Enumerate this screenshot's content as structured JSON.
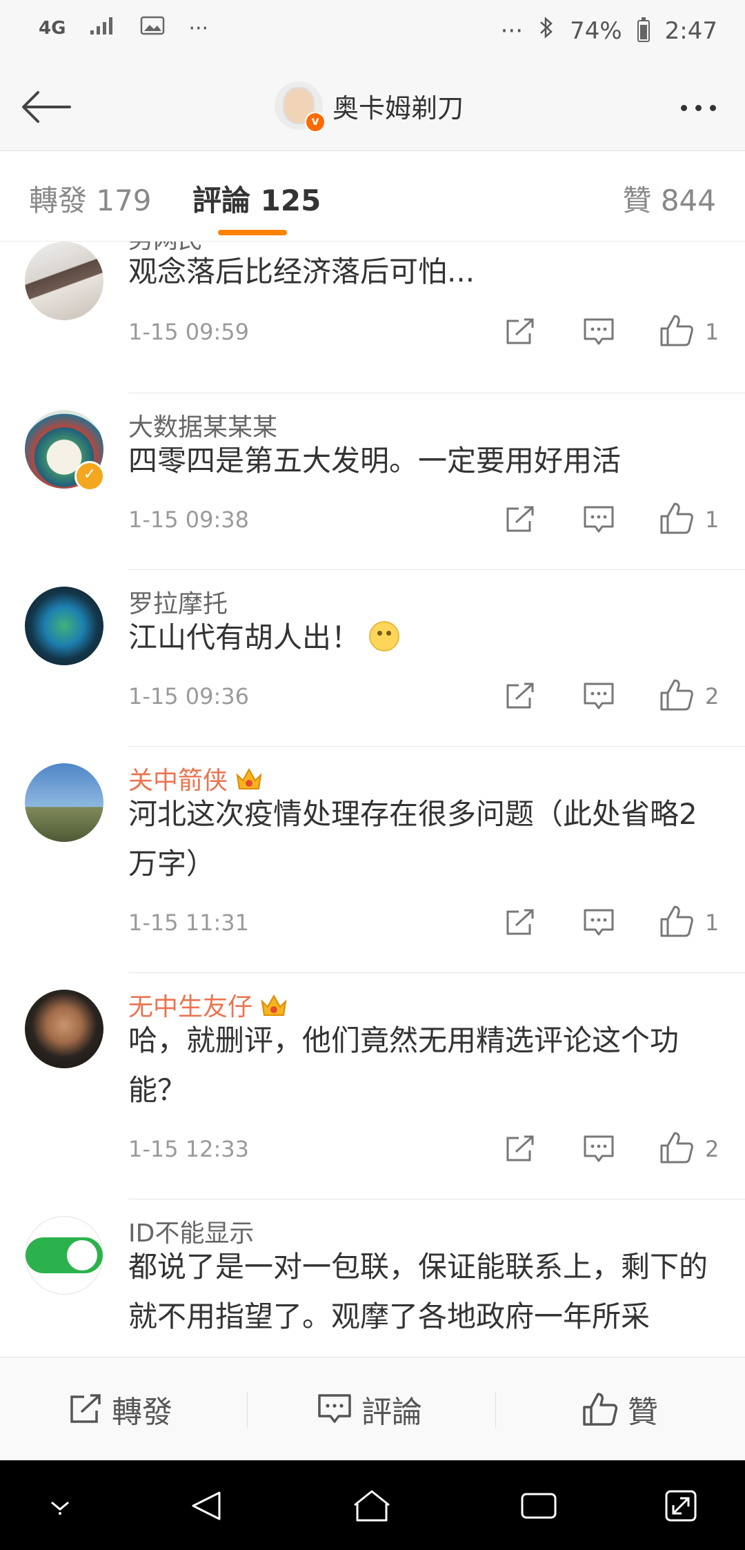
{
  "status_bar": {
    "network": "4G",
    "more_dots": "···",
    "right_dots": "···",
    "battery_percent": "74%",
    "battery_level": 0.74,
    "time": "2:47"
  },
  "header": {
    "title": "奥卡姆剃刀",
    "verified_badge": "v"
  },
  "tabs": {
    "repost": "轉發 179",
    "comments": "評論 125",
    "likes": "贊 844"
  },
  "comments": [
    {
      "user": "男网民",
      "text": "观念落后比经济落后可怕...",
      "time": "1-15 09:59",
      "like_count": "1",
      "badge": "",
      "vip": false
    },
    {
      "user": "大数据某某某",
      "text": "四零四是第五大发明。一定要用好用活",
      "time": "1-15 09:38",
      "like_count": "1",
      "badge": "✓",
      "vip": false
    },
    {
      "user": "罗拉摩托",
      "text": "江山代有胡人出！",
      "time": "1-15 09:36",
      "like_count": "2",
      "badge": "",
      "vip": false
    },
    {
      "user": "关中箭侠",
      "text": "河北这次疫情处理存在很多问题（此处省略2万字）",
      "time": "1-15 11:31",
      "like_count": "1",
      "badge": "",
      "vip": true
    },
    {
      "user": "无中生友仔",
      "text": "哈，就删评，他们竟然无用精选评论这个功能？",
      "time": "1-15 12:33",
      "like_count": "2",
      "badge": "",
      "vip": true
    },
    {
      "user": "ID不能显示",
      "text": "都说了是一对一包联，保证能联系上，剩下的就不用指望了。观摩了各地政府一年所采",
      "time": "",
      "like_count": "",
      "badge": "",
      "vip": false
    }
  ],
  "bottom_bar": {
    "repost": "轉發",
    "comment": "評論",
    "like": "贊"
  },
  "colors": {
    "accent": "#ff8200",
    "vip_name": "#eb7350",
    "verified": "#f2a71f"
  }
}
